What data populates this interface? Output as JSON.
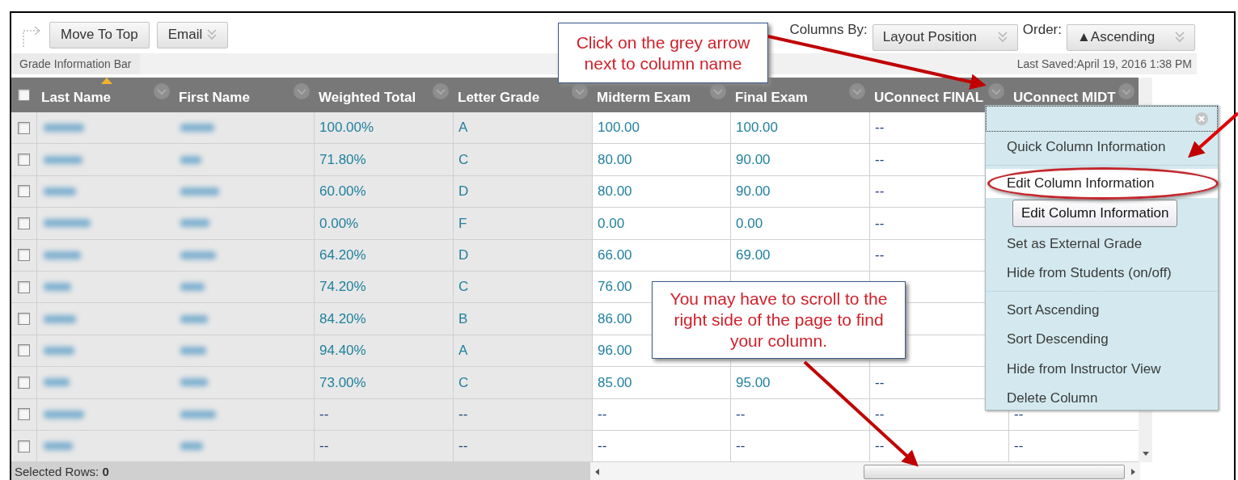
{
  "toolbar": {
    "buttons": [
      {
        "label": "Move To Top",
        "dropdown": false
      },
      {
        "label": "Email",
        "dropdown": true
      }
    ],
    "columns_by_label": "Columns By:",
    "columns_by_value": "Layout Position",
    "order_label": "Order:",
    "order_value": "▲Ascending"
  },
  "info_bar": {
    "label": "Grade Information Bar",
    "last_saved": "Last Saved:April 19, 2016 1:38 PM"
  },
  "table": {
    "all_selected": false,
    "name_columns": [
      {
        "label": "Last Name",
        "sorted": true
      },
      {
        "label": "First Name",
        "sorted": false
      }
    ],
    "columns": [
      {
        "label": "Weighted Total",
        "sorted": false
      },
      {
        "label": "Letter Grade",
        "sorted": false
      },
      {
        "label": "Midterm Exam",
        "sorted": false
      },
      {
        "label": "Final Exam",
        "sorted": false
      },
      {
        "label": "UConnect FINAL",
        "sorted": false
      },
      {
        "label": "UConnect MIDT",
        "sorted": false
      }
    ],
    "rows": [
      {
        "checked": false,
        "cells": [
          "100.00%",
          "A",
          "100.00",
          "100.00",
          "--"
        ]
      },
      {
        "checked": false,
        "cells": [
          "71.80%",
          "C",
          "80.00",
          "90.00",
          "--"
        ]
      },
      {
        "checked": false,
        "cells": [
          "60.00%",
          "D",
          "80.00",
          "90.00",
          "--"
        ]
      },
      {
        "checked": false,
        "cells": [
          "0.00%",
          "F",
          "0.00",
          "0.00",
          "--"
        ]
      },
      {
        "checked": false,
        "cells": [
          "64.20%",
          "D",
          "66.00",
          "69.00",
          "--"
        ]
      },
      {
        "checked": false,
        "cells": [
          "74.20%",
          "C",
          "76.00"
        ]
      },
      {
        "checked": false,
        "cells": [
          "84.20%",
          "B",
          "86.00"
        ]
      },
      {
        "checked": false,
        "cells": [
          "94.40%",
          "A",
          "96.00"
        ]
      },
      {
        "checked": false,
        "cells": [
          "73.00%",
          "C",
          "85.00",
          "95.00",
          "--"
        ]
      },
      {
        "checked": false,
        "cells": [
          "--",
          "--",
          "--",
          "--",
          "--",
          "--"
        ]
      },
      {
        "checked": false,
        "cells": [
          "--",
          "--",
          "--",
          "--",
          "--",
          "--"
        ]
      }
    ]
  },
  "status_bar": {
    "selected_rows": "Selected Rows: **0**"
  },
  "column_menu": {
    "items": [
      {
        "kind": "item",
        "label": "Quick Column Information",
        "selected": false
      },
      {
        "kind": "separator"
      },
      {
        "kind": "item",
        "label": "Edit Column Information",
        "selected": true
      },
      {
        "kind": "tooltip",
        "label": "Edit Column Information"
      },
      {
        "kind": "item",
        "label": "Set as External Grade",
        "selected": false
      },
      {
        "kind": "item",
        "label": "Hide from Students (on/off)",
        "selected": false
      },
      {
        "kind": "separator"
      },
      {
        "kind": "item",
        "label": "Sort Ascending",
        "selected": false
      },
      {
        "kind": "item",
        "label": "Sort Descending",
        "selected": false
      },
      {
        "kind": "item",
        "label": "Hide from Instructor View",
        "selected": false
      },
      {
        "kind": "item",
        "label": "Delete Column",
        "selected": false
      }
    ]
  },
  "callouts": [
    {
      "text": "Click on the grey arrow next to column name"
    },
    {
      "text": "You may have to scroll to the right side of the page to find your column."
    }
  ]
}
